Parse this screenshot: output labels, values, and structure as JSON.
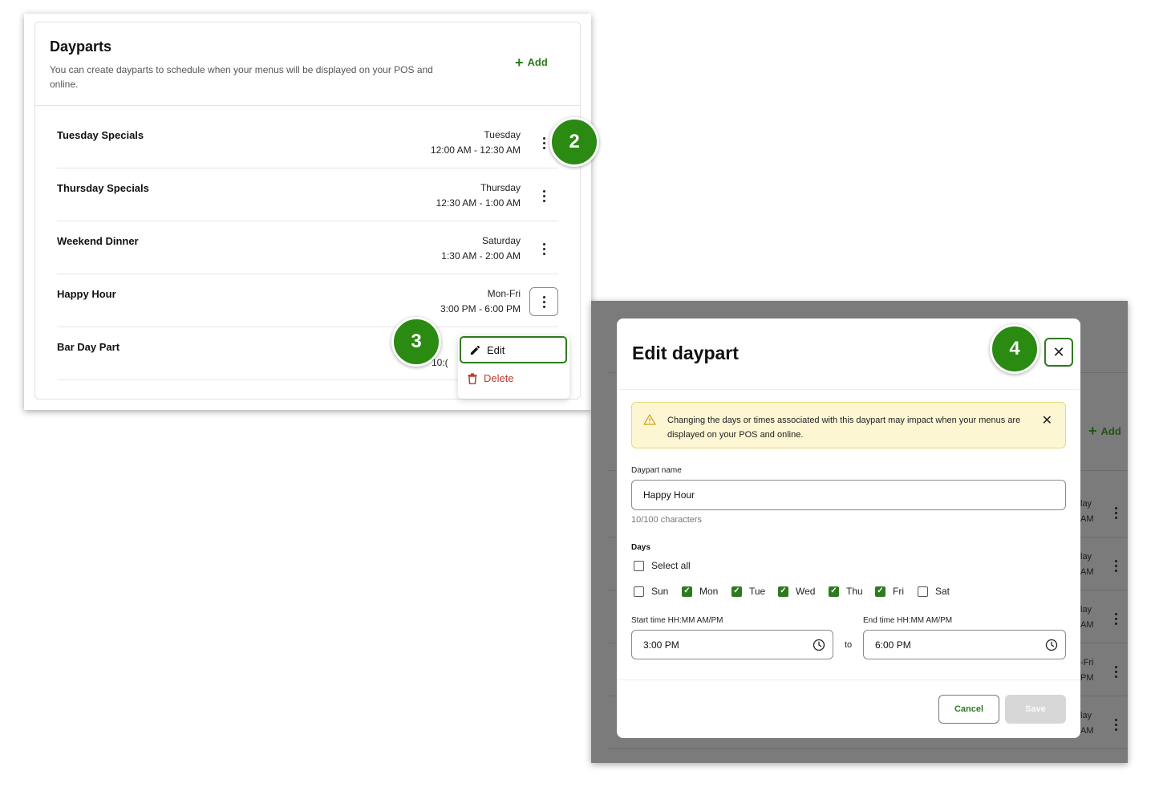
{
  "dayparts_page": {
    "title": "Dayparts",
    "description": "You can create dayparts to schedule when your menus will be displayed on your POS and online.",
    "add_label": "Add",
    "rows": [
      {
        "name": "Tuesday Specials",
        "day": "Tuesday",
        "time": "12:00 AM - 12:30 AM"
      },
      {
        "name": "Thursday Specials",
        "day": "Thursday",
        "time": "12:30 AM - 1:00 AM"
      },
      {
        "name": "Weekend Dinner",
        "day": "Saturday",
        "time": "1:30 AM - 2:00 AM"
      },
      {
        "name": "Happy Hour",
        "day": "Mon-Fri",
        "time": "3:00 PM - 6:00 PM"
      },
      {
        "name": "Bar Day Part",
        "day": "",
        "time": "10:("
      }
    ],
    "menu": {
      "edit_label": "Edit",
      "delete_label": "Delete"
    }
  },
  "badges": {
    "b2": "2",
    "b3": "3",
    "b4": "4"
  },
  "background": {
    "add_label": "Add",
    "fragments": [
      {
        "a": "lay",
        "b": "AM"
      },
      {
        "a": "lay",
        "b": "AM"
      },
      {
        "a": "lay",
        "b": "AM"
      },
      {
        "a": "-Fri",
        "b": "PM"
      },
      {
        "a": "lay",
        "b": "AM"
      }
    ]
  },
  "modal": {
    "title": "Edit daypart",
    "alert_text": "Changing the days or times associated with this daypart may impact when your menus are displayed on your POS and online.",
    "name_label": "Daypart name",
    "name_value": "Happy Hour",
    "char_hint": "10/100 characters",
    "days_label": "Days",
    "select_all_label": "Select all",
    "days": [
      {
        "label": "Sun",
        "checked": false
      },
      {
        "label": "Mon",
        "checked": true
      },
      {
        "label": "Tue",
        "checked": true
      },
      {
        "label": "Wed",
        "checked": true
      },
      {
        "label": "Thu",
        "checked": true
      },
      {
        "label": "Fri",
        "checked": true
      },
      {
        "label": "Sat",
        "checked": false
      }
    ],
    "start_label": "Start time HH:MM AM/PM",
    "start_value": "3:00 PM",
    "to_label": "to",
    "end_label": "End time HH:MM AM/PM",
    "end_value": "6:00 PM",
    "cancel_label": "Cancel",
    "save_label": "Save"
  },
  "colors": {
    "brand_green": "#2f7a1f",
    "badge_green": "#2a8a12",
    "delete_red": "#c33a2b",
    "alert_bg": "#fcf6d3"
  },
  "icons": [
    "plus-icon",
    "kebab-icon",
    "pencil-icon",
    "trash-icon",
    "close-icon",
    "warning-icon",
    "clock-icon",
    "check-icon"
  ]
}
